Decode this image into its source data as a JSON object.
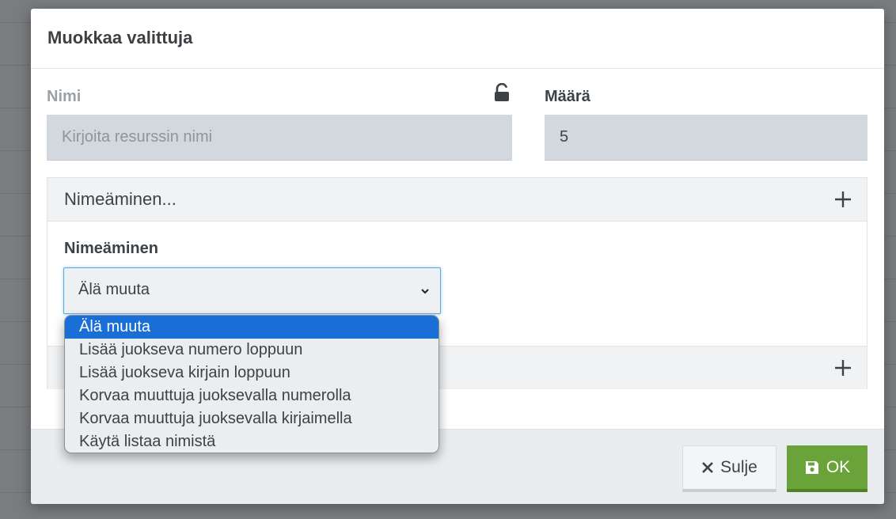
{
  "modal": {
    "title": "Muokkaa valittuja"
  },
  "fields": {
    "name_label": "Nimi",
    "name_placeholder": "Kirjoita resurssin nimi",
    "name_value": "",
    "quantity_label": "Määrä",
    "quantity_value": "5"
  },
  "naming_section": {
    "header": "Nimeäminen...",
    "field_label": "Nimeäminen",
    "selected_value": "Älä muuta",
    "options": [
      "Älä muuta",
      "Lisää juokseva numero loppuun",
      "Lisää juokseva kirjain loppuun",
      "Korvaa muuttuja juoksevalla numerolla",
      "Korvaa muuttuja juoksevalla kirjaimella",
      "Käytä listaa nimistä"
    ],
    "highlighted_index": 0
  },
  "footer": {
    "close_label": "Sulje",
    "ok_label": "OK"
  },
  "colors": {
    "ok_button": "#6aa339",
    "selected_option": "#1a6fd6",
    "input_background": "#d2d8dd",
    "focus_border": "#5aa9dd"
  },
  "icons": {
    "lock": "unlock-icon",
    "expand": "plus-icon",
    "select_arrow": "chevron-down-icon",
    "close": "close-icon",
    "save": "save-icon"
  }
}
